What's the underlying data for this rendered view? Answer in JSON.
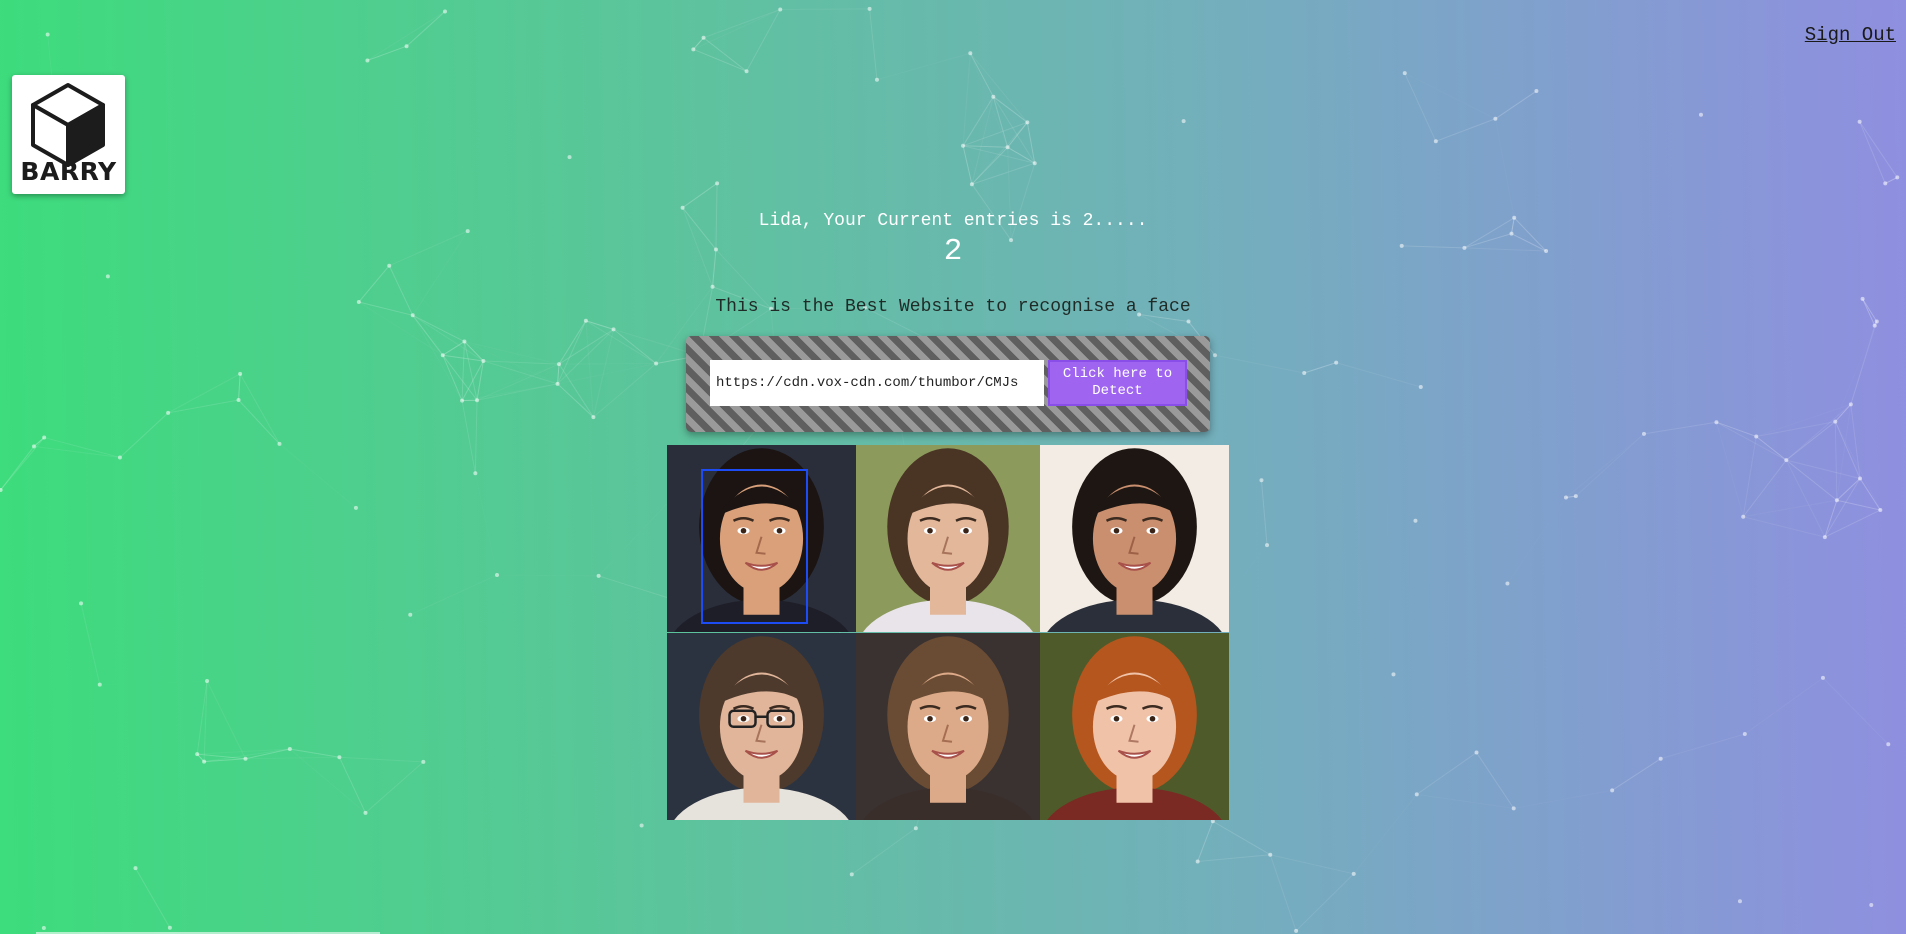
{
  "nav": {
    "sign_out_label": "Sign Out"
  },
  "logo": {
    "text": "BARRY",
    "icon": "cube-logo-icon"
  },
  "status": {
    "entries_text": "Lida, Your Current entries is 2.....",
    "entry_count": "2"
  },
  "tagline": "This is the Best Website to recognise a face",
  "form": {
    "url_value": "https://cdn.vox-cdn.com/thumbor/CMJs",
    "detect_label": "Click here to Detect"
  },
  "colors": {
    "gradient_start": "#3ddc7c",
    "gradient_end": "#8f8fe0",
    "button": "#a065f0",
    "face_box": "#1d4cf5"
  },
  "faces": [
    {
      "name": "woman-dark-hair",
      "bg": "#2a2e3a",
      "skin": "#d9a07a",
      "hair": "#1b1412",
      "shirt": "#1e1e28",
      "detected": true
    },
    {
      "name": "boy-brown-hair",
      "bg": "#8c9a5c",
      "skin": "#e2b79a",
      "hair": "#4a3424",
      "shirt": "#e8e4ea",
      "detected": false
    },
    {
      "name": "man-smiling",
      "bg": "#f2ece4",
      "skin": "#c98f6e",
      "hair": "#1e1612",
      "shirt": "#2b2f3a",
      "detected": false
    },
    {
      "name": "woman-glasses",
      "bg": "#2c3340",
      "skin": "#e0b59a",
      "hair": "#4e3a2c",
      "shirt": "#e6e2dc",
      "detected": false
    },
    {
      "name": "woman-long-brown-hair",
      "bg": "#3a3230",
      "skin": "#dcaa88",
      "hair": "#6a4c34",
      "shirt": "#3a2e2a",
      "detected": false
    },
    {
      "name": "woman-red-hair",
      "bg": "#4e5a2a",
      "skin": "#f0c2a8",
      "hair": "#b4561e",
      "shirt": "#7a2a22",
      "detected": false
    }
  ]
}
